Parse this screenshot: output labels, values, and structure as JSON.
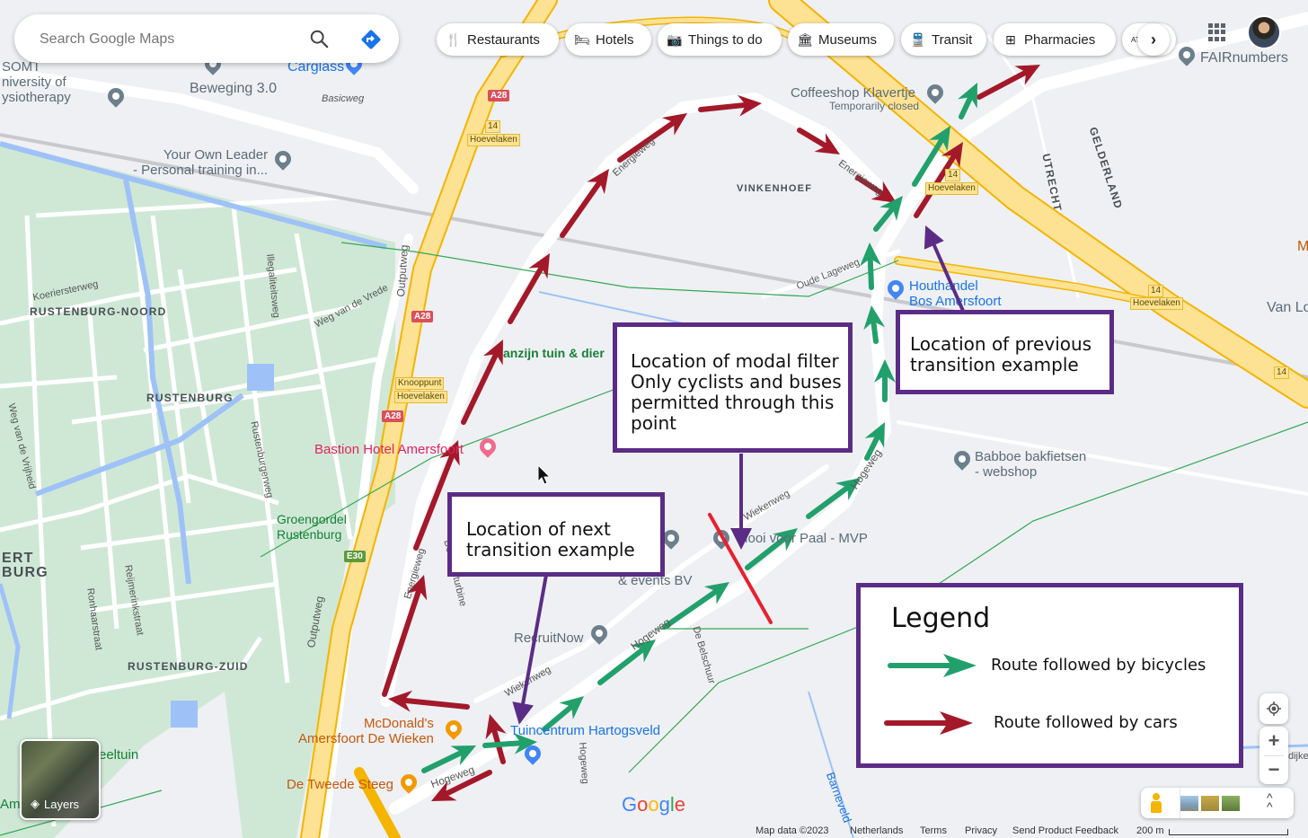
{
  "search": {
    "placeholder": "Search Google Maps"
  },
  "chips": [
    {
      "label": "Restaurants",
      "icon": "restaurant-icon"
    },
    {
      "label": "Hotels",
      "icon": "hotel-icon"
    },
    {
      "label": "Things to do",
      "icon": "camera-icon"
    },
    {
      "label": "Museums",
      "icon": "museum-icon"
    },
    {
      "label": "Transit",
      "icon": "transit-icon"
    },
    {
      "label": "Pharmacies",
      "icon": "pharmacy-icon"
    },
    {
      "label": "ATMs",
      "icon": "atm-icon"
    }
  ],
  "map_labels": {
    "poi": {
      "somt": "SOMT\nniversity of\nysiotherapy",
      "beweging": "Beweging 3.0",
      "carglass": "Carglass",
      "basicweg": "Basicweg",
      "your_own_leader": "Your Own Leader\n- Personal training in...",
      "coffeeshop": "Coffeeshop Klavertje",
      "coffeeshop_status": "Temporarily closed",
      "fairnumbers": "FAIRnumbers",
      "houthandel": "Houthandel\nBos Amersfoort",
      "van_lo": "Van Lo",
      "m_label": "M",
      "babboe": "Babboe bakfietsen\n- webshop",
      "tuin_dier": "anzijn tuin & dier",
      "bastion": "Bastion Hotel Amersfoort",
      "groengordel": "Groengordel\nRustenburg",
      "recruitnow": "RecruitNow",
      "schuur": "schuur\n& events BV",
      "mooi_paal": "Mooi voor Paal - MVP",
      "mcdonalds": "McDonald's\nAmersfoort De Wieken",
      "tuincentrum": "Tuincentrum Hartogsveld",
      "tweede_steeg": "De Tweede Steeg",
      "speeltuin": "eeltuin",
      "am": "Am",
      "dijke": "dijke"
    },
    "areas": {
      "rustenburg_noord": "RUSTENBURG-NOORD",
      "rustenburg": "RUSTENBURG",
      "rustenburg_zuid": "RUSTENBURG-ZUID",
      "vinkenhoef": "VINKENHOEF",
      "utrecht": "UTRECHT",
      "gelderland": "GELDERLAND",
      "ert_burg": "ERT\nBURG"
    },
    "streets": {
      "koeriersterweg": "Koeriersterweg",
      "illegaliteitsweg": "Illegaliteitsweg",
      "weg_van_de_vrede": "Weg van de Vrede",
      "outputweg": "Outputweg",
      "weg_van_de_vrijheid": "Weg van de Vrijheid",
      "rustenburgerweg": "Rustenburgerweg",
      "reijmerinkstraat": "Reijmerinkstraat",
      "ronhaarstraat": "Ronhaarstraat",
      "energieweg": "Energieweg",
      "oude_lageweg": "Oude Lageweg",
      "hogeweg": "Hogeweg",
      "wiekenweg": "Wiekenweg",
      "de_windturbine": "De Windturbine",
      "de_belschuur": "De Belschuur",
      "barneveld": "Barneveld"
    },
    "shields": {
      "a28": "A28",
      "e30": "E30",
      "exit14": "14",
      "hoevelaken": "Hoevelaken",
      "knooppunt": "Knooppunt",
      "knooppunt_hoevelaken": "Hoevelaken"
    }
  },
  "annotations": {
    "modal_filter": "Location of modal filter\nOnly cyclists and buses\npermitted through this\npoint",
    "previous_example": "Location of previous\ntransition example",
    "next_example": "Location of next\ntransition example"
  },
  "legend": {
    "title": "Legend",
    "items": [
      {
        "label": "Route followed by bicycles",
        "color": "#22a06b"
      },
      {
        "label": "Route followed by cars",
        "color": "#a3192a"
      }
    ]
  },
  "colors": {
    "bike_route": "#22a06b",
    "car_route": "#a3192a",
    "modal_filter": "#e8202f",
    "annotation_border": "#5b2c86",
    "motorway": "#fde293"
  },
  "layers": {
    "label": "Layers"
  },
  "footer": {
    "map_data": "Map data ©2023",
    "country": "Netherlands",
    "terms": "Terms",
    "privacy": "Privacy",
    "feedback": "Send Product Feedback",
    "scale": "200 m"
  },
  "google_logo": "Google"
}
